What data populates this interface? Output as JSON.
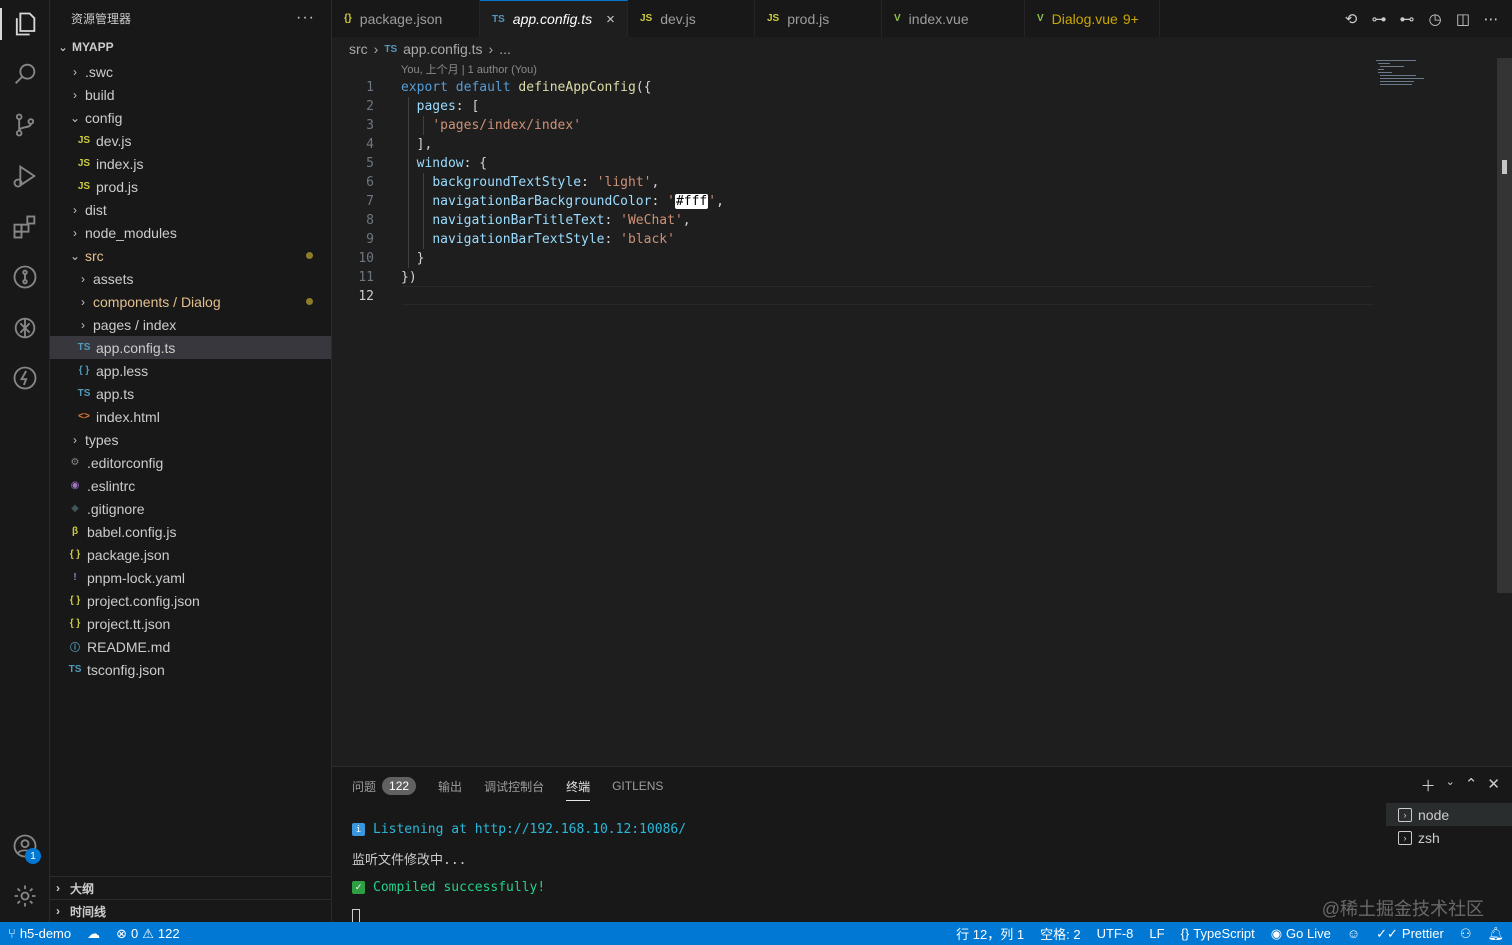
{
  "activity": {
    "items": [
      "explorer-icon",
      "search-icon",
      "source-control-icon",
      "run-debug-icon",
      "extensions-icon",
      "gitlens-icon",
      "chatgpt-icon",
      "thunder-icon"
    ],
    "account_badge": "1"
  },
  "sidebar": {
    "title": "资源管理器",
    "more": "···",
    "root": "MYAPP",
    "items": [
      {
        "label": ".swc",
        "type": "folder",
        "open": false,
        "depth": 1
      },
      {
        "label": "build",
        "type": "folder",
        "open": false,
        "depth": 1
      },
      {
        "label": "config",
        "type": "folder",
        "open": true,
        "depth": 1
      },
      {
        "label": "dev.js",
        "type": "js",
        "depth": 2
      },
      {
        "label": "index.js",
        "type": "js",
        "depth": 2
      },
      {
        "label": "prod.js",
        "type": "js",
        "depth": 2
      },
      {
        "label": "dist",
        "type": "folder",
        "open": false,
        "depth": 1
      },
      {
        "label": "node_modules",
        "type": "folder",
        "open": false,
        "depth": 1
      },
      {
        "label": "src",
        "type": "folder",
        "open": true,
        "depth": 1,
        "modified": true
      },
      {
        "label": "assets",
        "type": "folder",
        "open": false,
        "depth": 2
      },
      {
        "label": "components / Dialog",
        "type": "folder",
        "open": false,
        "depth": 2,
        "modified": true
      },
      {
        "label": "pages / index",
        "type": "folder",
        "open": false,
        "depth": 2
      },
      {
        "label": "app.config.ts",
        "type": "ts",
        "depth": 2,
        "selected": true
      },
      {
        "label": "app.less",
        "type": "less",
        "depth": 2
      },
      {
        "label": "app.ts",
        "type": "ts",
        "depth": 2
      },
      {
        "label": "index.html",
        "type": "html",
        "depth": 2
      },
      {
        "label": "types",
        "type": "folder",
        "open": false,
        "depth": 1
      },
      {
        "label": ".editorconfig",
        "type": "gear",
        "depth": 1
      },
      {
        "label": ".eslintrc",
        "type": "eslint",
        "depth": 1
      },
      {
        "label": ".gitignore",
        "type": "git",
        "depth": 1
      },
      {
        "label": "babel.config.js",
        "type": "babel",
        "depth": 1
      },
      {
        "label": "package.json",
        "type": "json",
        "depth": 1
      },
      {
        "label": "pnpm-lock.yaml",
        "type": "yaml",
        "depth": 1
      },
      {
        "label": "project.config.json",
        "type": "json",
        "depth": 1
      },
      {
        "label": "project.tt.json",
        "type": "json",
        "depth": 1
      },
      {
        "label": "README.md",
        "type": "info",
        "depth": 1
      },
      {
        "label": "tsconfig.json",
        "type": "tsconfig",
        "depth": 1
      }
    ],
    "outline": "大纲",
    "timeline": "时间线"
  },
  "tabs": [
    {
      "icon": "{}",
      "label": "package.json",
      "color": "#cbcb41"
    },
    {
      "icon": "TS",
      "label": "app.config.ts",
      "color": "#519aba",
      "active": true,
      "close": "×"
    },
    {
      "icon": "JS",
      "label": "dev.js",
      "color": "#cbcb41"
    },
    {
      "icon": "JS",
      "label": "prod.js",
      "color": "#cbcb41"
    },
    {
      "icon": "V",
      "label": "index.vue",
      "color": "#8dc149"
    },
    {
      "icon": "V",
      "label": "Dialog.vue",
      "badge": "9+",
      "color": "#8dc149",
      "warn": true
    }
  ],
  "breadcrumb": {
    "folder": "src",
    "file_icon": "TS",
    "file": "app.config.ts",
    "more": "..."
  },
  "blame": "You, 上个月 | 1 author (You)",
  "code": [
    [
      [
        "kw",
        "export "
      ],
      [
        "kw",
        "default "
      ],
      [
        "fn",
        "defineAppConfig"
      ],
      [
        "pun",
        "({"
      ]
    ],
    [
      [
        "pun",
        "  "
      ],
      [
        "prop",
        "pages"
      ],
      [
        "pun",
        ": ["
      ]
    ],
    [
      [
        "pun",
        "    "
      ],
      [
        "str",
        "'pages/index/index'"
      ]
    ],
    [
      [
        "pun",
        "  ],"
      ]
    ],
    [
      [
        "pun",
        "  "
      ],
      [
        "prop",
        "window"
      ],
      [
        "pun",
        ": {"
      ]
    ],
    [
      [
        "pun",
        "    "
      ],
      [
        "prop",
        "backgroundTextStyle"
      ],
      [
        "pun",
        ": "
      ],
      [
        "str",
        "'light'"
      ],
      [
        "pun",
        ","
      ]
    ],
    [
      [
        "pun",
        "    "
      ],
      [
        "prop",
        "navigationBarBackgroundColor"
      ],
      [
        "pun",
        ": "
      ],
      [
        "str",
        "'"
      ],
      [
        "hl",
        "#fff"
      ],
      [
        "str",
        "'"
      ],
      [
        "pun",
        ","
      ]
    ],
    [
      [
        "pun",
        "    "
      ],
      [
        "prop",
        "navigationBarTitleText"
      ],
      [
        "pun",
        ": "
      ],
      [
        "str",
        "'WeChat'"
      ],
      [
        "pun",
        ","
      ]
    ],
    [
      [
        "pun",
        "    "
      ],
      [
        "prop",
        "navigationBarTextStyle"
      ],
      [
        "pun",
        ": "
      ],
      [
        "str",
        "'black'"
      ]
    ],
    [
      [
        "pun",
        "  }"
      ]
    ],
    [
      [
        "pun",
        "})"
      ]
    ],
    []
  ],
  "panel": {
    "tabs": [
      {
        "label": "问题",
        "count": "122"
      },
      {
        "label": "输出"
      },
      {
        "label": "调试控制台"
      },
      {
        "label": "终端",
        "active": true
      },
      {
        "label": "GITLENS"
      }
    ],
    "terminal": {
      "listening": "Listening at http://192.168.10.12:10086/",
      "watching": "监听文件修改中...",
      "compiled": "Compiled successfully!"
    },
    "terminals": [
      {
        "label": "node",
        "active": true
      },
      {
        "label": "zsh"
      }
    ],
    "watermark": "@稀土掘金技术社区"
  },
  "status": {
    "branch": "h5-demo",
    "errors": "0",
    "warnings": "122",
    "position": "行 12，列 1",
    "spaces": "空格: 2",
    "encoding": "UTF-8",
    "eol": "LF",
    "language": "TypeScript",
    "golive": "Go Live",
    "prettier": "Prettier"
  }
}
